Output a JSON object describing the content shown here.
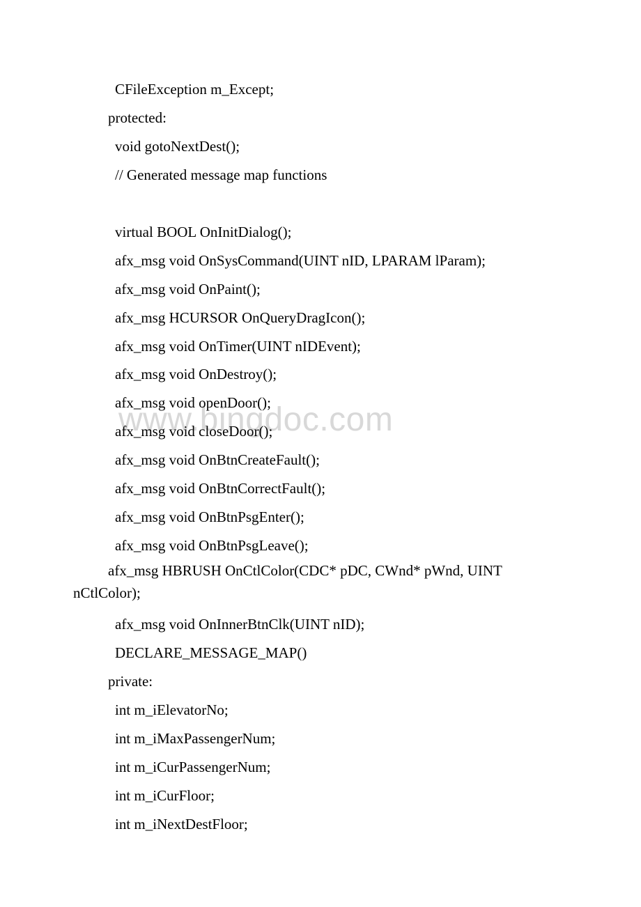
{
  "watermark": "www.bingdoc.com",
  "lines": [
    {
      "indent": "indent2",
      "text": "CFileException m_Except;"
    },
    {
      "indent": "indent1",
      "text": "protected:"
    },
    {
      "indent": "indent2",
      "text": "void gotoNextDest();"
    },
    {
      "indent": "indent2",
      "text": "// Generated message map functions"
    },
    {
      "blank": true
    },
    {
      "indent": "indent2",
      "text": "virtual BOOL OnInitDialog();"
    },
    {
      "indent": "indent2",
      "text": "afx_msg void OnSysCommand(UINT nID, LPARAM lParam);"
    },
    {
      "indent": "indent2",
      "text": "afx_msg void OnPaint();"
    },
    {
      "indent": "indent2",
      "text": "afx_msg HCURSOR OnQueryDragIcon();"
    },
    {
      "indent": "indent2",
      "text": "afx_msg void OnTimer(UINT nIDEvent);"
    },
    {
      "indent": "indent2",
      "text": "afx_msg void OnDestroy();"
    },
    {
      "indent": "indent2",
      "text": "afx_msg void openDoor();"
    },
    {
      "indent": "indent2",
      "text": "afx_msg void closeDoor();"
    },
    {
      "indent": "indent2",
      "text": "afx_msg void OnBtnCreateFault();"
    },
    {
      "indent": "indent2",
      "text": "afx_msg void OnBtnCorrectFault();"
    },
    {
      "indent": "indent2",
      "text": "afx_msg void OnBtnPsgEnter();"
    },
    {
      "indent": "indent2",
      "text": "afx_msg void OnBtnPsgLeave();"
    }
  ],
  "wrapped": {
    "first": "afx_msg HBRUSH OnCtlColor(CDC* pDC, CWnd* pWnd, UINT ",
    "second": "nCtlColor);"
  },
  "lines_after": [
    {
      "indent": "indent2",
      "text": "afx_msg void OnInnerBtnClk(UINT nID);"
    },
    {
      "indent": "indent2",
      "text": "DECLARE_MESSAGE_MAP()"
    },
    {
      "indent": "indent1",
      "text": "private:"
    },
    {
      "indent": "indent2",
      "text": "int m_iElevatorNo;"
    },
    {
      "indent": "indent2",
      "text": "int m_iMaxPassengerNum;"
    },
    {
      "indent": "indent2",
      "text": "int m_iCurPassengerNum;"
    },
    {
      "indent": "indent2",
      "text": "int m_iCurFloor;"
    },
    {
      "indent": "indent2",
      "text": "int m_iNextDestFloor;"
    }
  ]
}
